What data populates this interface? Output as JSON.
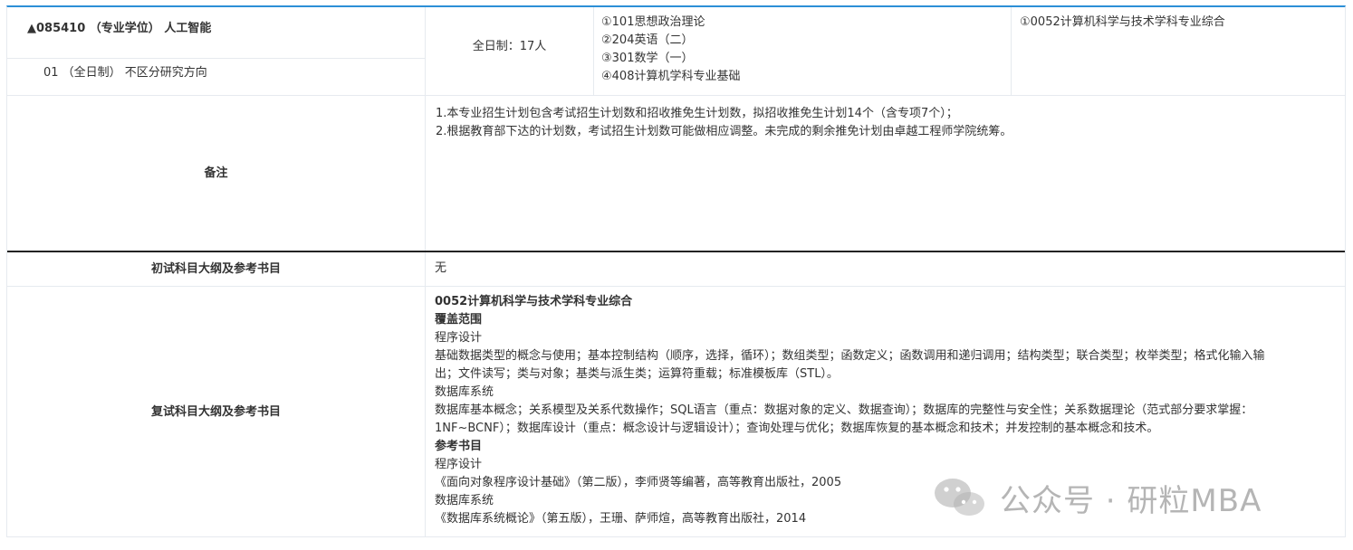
{
  "major": {
    "title": "▲085410 （专业学位） 人工智能",
    "direction": "01 （全日制） 不区分研究方向",
    "quota": "全日制：17人",
    "exam_subjects": [
      "①101思想政治理论",
      "②204英语（二）",
      "③301数学（一）",
      "④408计算机学科专业基础"
    ],
    "retest_subject": "①0052计算机科学与技术学科专业综合"
  },
  "remarks": {
    "label": "备注",
    "lines": [
      "1.本专业招生计划包含考试招生计划数和招收推免生计划数，拟招收推免生计划14个（含专项7个）；",
      "2.根据教育部下达的计划数，考试招生计划数可能做相应调整。未完成的剩余推免计划由卓越工程师学院统筹。"
    ]
  },
  "prelim": {
    "label": "初试科目大纲及参考书目",
    "value": "无"
  },
  "retest": {
    "label": "复试科目大纲及参考书目",
    "subject_title": "0052计算机科学与技术学科专业综合",
    "coverage_heading": "覆盖范围",
    "prog_heading": "程序设计",
    "prog_line1": "基础数据类型的概念与使用；基本控制结构（顺序，选择，循环）；数组类型；函数定义；函数调用和递归调用；结构类型；联合类型；枚举类型；格式化输入输",
    "prog_line2": "出；文件读写；类与对象；基类与派生类；运算符重载；标准模板库（STL）。",
    "db_heading": "数据库系统",
    "db_line1": "数据库基本概念；关系模型及关系代数操作；SQL语言（重点：数据对象的定义、数据查询）；数据库的完整性与安全性；关系数据理论（范式部分要求掌握：",
    "db_line2": "1NF~BCNF）；数据库设计（重点：概念设计与逻辑设计）；查询处理与优化；数据库恢复的基本概念和技术；并发控制的基本概念和技术。",
    "ref_heading": "参考书目",
    "ref_prog_heading": "程序设计",
    "ref_prog_book": "《面向对象程序设计基础》（第二版），李师贤等编著，高等教育出版社，2005",
    "ref_db_heading": "数据库系统",
    "ref_db_book": "《数据库系统概论》（第五版），王珊、萨师煊，高等教育出版社，2014"
  },
  "watermark": {
    "text": "公众号 · 研粒MBA",
    "icon": "wechat-icon"
  },
  "colors": {
    "accent": "#2c8fd6",
    "border": "#e6eaef",
    "text": "#333333"
  }
}
